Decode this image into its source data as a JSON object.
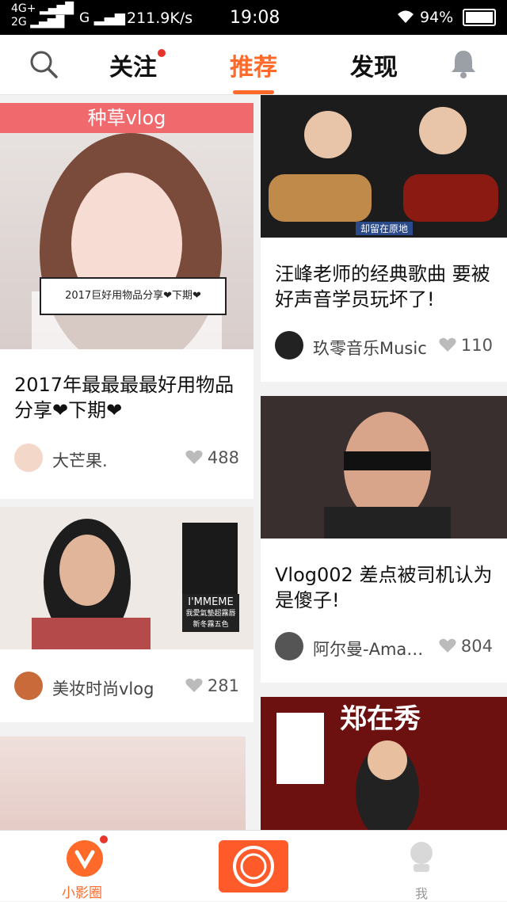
{
  "status": {
    "network_top": "4G+",
    "network_bottom": "2G",
    "signal2": "G",
    "speed": "211.9K/s",
    "time": "19:08",
    "battery": "94%"
  },
  "topnav": {
    "follow": "关注",
    "recommend": "推荐",
    "discover": "发现"
  },
  "cards": [
    {
      "overlay_banner": "种草vlog",
      "overlay_caption": "2017巨好用物品分享❤下期❤",
      "title": "2017年最最最最好用物品分享❤下期❤",
      "author": "大芒果.",
      "likes": "488"
    },
    {
      "overlay_label": "却留在原地",
      "title": "汪峰老师的经典歌曲 要被好声音学员玩坏了!",
      "author": "玖零音乐Music",
      "likes": "110"
    },
    {
      "overlay_text": "I'MMEME",
      "overlay_sub": "我愛氣墊超霧唇 新冬霧五色",
      "author": "美妆时尚vlog",
      "likes": "281"
    },
    {
      "title": "Vlog002 差点被司机认为是傻子!",
      "author": "阿尔曼-Ama…",
      "likes": "804"
    },
    {
      "overlay_text": "郑在秀"
    }
  ],
  "bottomnav": {
    "home": "小影圈",
    "me": "我"
  },
  "colors": {
    "accent": "#ff6a2a",
    "badge": "#e8342b"
  }
}
